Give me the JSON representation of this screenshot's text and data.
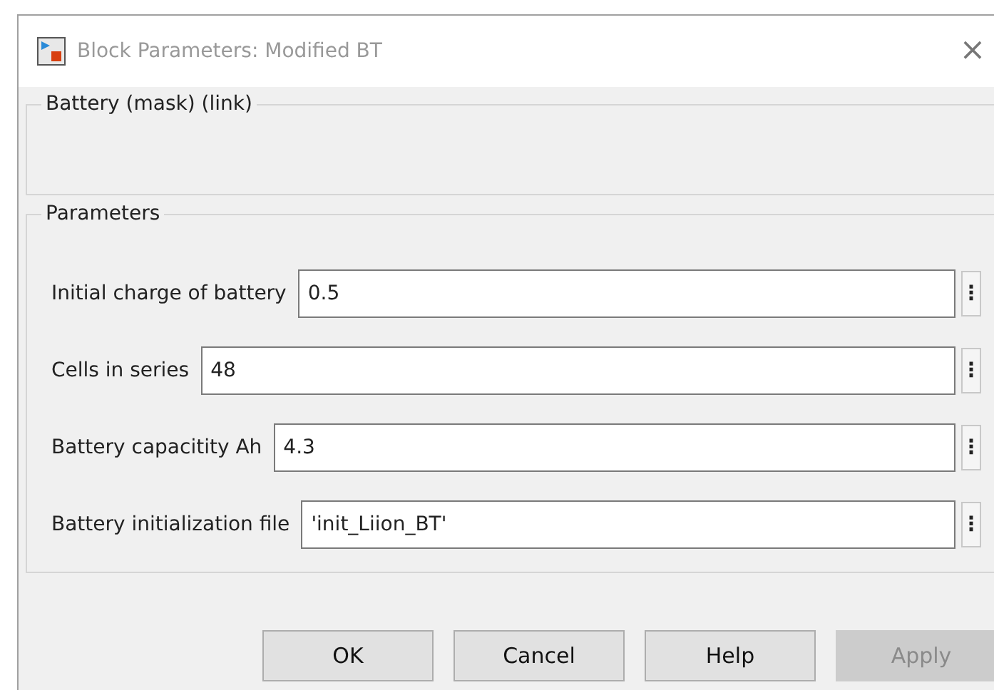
{
  "window": {
    "title": "Block Parameters: Modified BT",
    "close": "×"
  },
  "description_group": {
    "title": "Battery (mask) (link)"
  },
  "parameters_group": {
    "title": "Parameters",
    "fields": [
      {
        "label": "Initial charge of battery",
        "value": "0.5",
        "menu": "⋮"
      },
      {
        "label": "Cells in series",
        "value": "48",
        "menu": "⋮"
      },
      {
        "label": "Battery capacitity Ah",
        "value": "4.3",
        "menu": "⋮"
      },
      {
        "label": "Battery initialization file",
        "value": "'init_Liion_BT'",
        "menu": "⋮"
      }
    ]
  },
  "buttons": [
    {
      "label": "OK",
      "disabled": false
    },
    {
      "label": "Cancel",
      "disabled": false
    },
    {
      "label": "Help",
      "disabled": false
    },
    {
      "label": "Apply",
      "disabled": true
    }
  ]
}
